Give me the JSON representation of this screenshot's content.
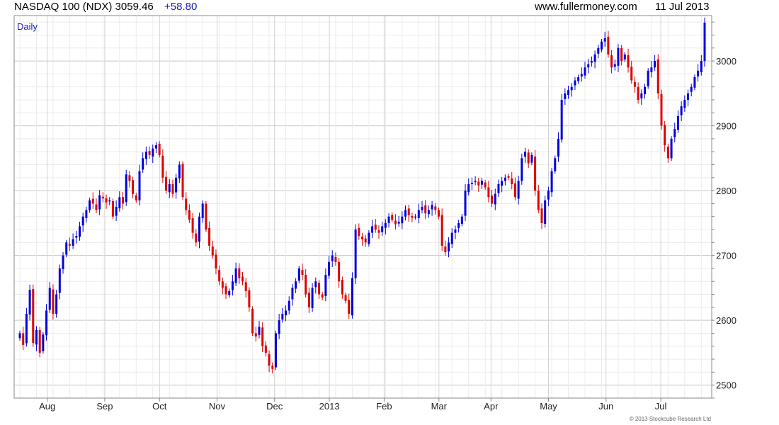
{
  "header": {
    "title": "NASDAQ 100 (NDX) 3059.46",
    "change": "+58.80",
    "site": "www.fullermoney.com",
    "date": "11 Jul 2013"
  },
  "colors": {
    "up": "#0000dd",
    "down": "#dd0000",
    "grid": "#dcdcdc",
    "frame": "#888888"
  },
  "chart_data": {
    "type": "candlestick",
    "period_label": "Daily",
    "copyright": "© 2013 Stockcube Research Ltd",
    "ylim": [
      2480,
      3070
    ],
    "y_ticks": [
      2500,
      2600,
      2700,
      2800,
      2900,
      3000
    ],
    "x_labels": [
      "Aug",
      "Sep",
      "Oct",
      "Nov",
      "Dec",
      "2013",
      "Feb",
      "Mar",
      "Apr",
      "May",
      "Jun",
      "Jul"
    ],
    "grid": true,
    "closes": [
      2580,
      2562,
      2610,
      2647,
      2565,
      2585,
      2550,
      2578,
      2615,
      2650,
      2610,
      2640,
      2680,
      2700,
      2720,
      2715,
      2725,
      2730,
      2745,
      2760,
      2770,
      2785,
      2780,
      2770,
      2793,
      2788,
      2782,
      2785,
      2760,
      2775,
      2790,
      2780,
      2825,
      2815,
      2795,
      2785,
      2830,
      2850,
      2860,
      2855,
      2865,
      2870,
      2855,
      2820,
      2800,
      2810,
      2795,
      2820,
      2840,
      2790,
      2770,
      2755,
      2735,
      2720,
      2760,
      2780,
      2740,
      2715,
      2700,
      2680,
      2660,
      2650,
      2640,
      2645,
      2660,
      2680,
      2665,
      2660,
      2645,
      2620,
      2580,
      2575,
      2590,
      2560,
      2550,
      2530,
      2525,
      2580,
      2600,
      2610,
      2615,
      2630,
      2650,
      2660,
      2680,
      2670,
      2640,
      2620,
      2650,
      2660,
      2640,
      2635,
      2670,
      2690,
      2700,
      2690,
      2660,
      2640,
      2630,
      2610,
      2665,
      2740,
      2730,
      2725,
      2720,
      2735,
      2745,
      2740,
      2735,
      2745,
      2750,
      2760,
      2755,
      2748,
      2752,
      2760,
      2770,
      2762,
      2758,
      2760,
      2770,
      2775,
      2765,
      2770,
      2778,
      2770,
      2760,
      2715,
      2705,
      2720,
      2735,
      2740,
      2750,
      2760,
      2800,
      2810,
      2812,
      2815,
      2808,
      2815,
      2805,
      2790,
      2780,
      2795,
      2810,
      2815,
      2820,
      2820,
      2810,
      2790,
      2815,
      2850,
      2860,
      2842,
      2855,
      2800,
      2770,
      2750,
      2785,
      2800,
      2830,
      2850,
      2880,
      2940,
      2950,
      2955,
      2960,
      2970,
      2975,
      2980,
      2990,
      2995,
      3000,
      3010,
      3020,
      3030,
      3035,
      3010,
      2990,
      2995,
      3020,
      3000,
      3010,
      2990,
      2970,
      2960,
      2940,
      2950,
      2960,
      2985,
      2990,
      3000,
      2950,
      2900,
      2870,
      2850,
      2880,
      2895,
      2915,
      2930,
      2940,
      2950,
      2960,
      2975,
      2985,
      3000,
      3059
    ]
  }
}
